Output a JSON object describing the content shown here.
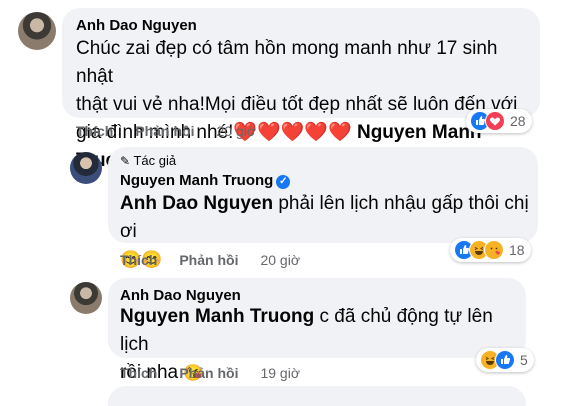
{
  "comments": [
    {
      "author": "Anh Dao Nguyen",
      "text_line1": "Chúc zai đẹp có tâm hồn mong manh như 17 sinh nhật",
      "text_line2": "thật vui vẻ nha!Mọi điều tốt đẹp nhất sẽ luôn đến với",
      "text_line3": "gia đình mình nhé!",
      "hearts": "❤️❤️❤️❤️❤️",
      "mention": "Nguyen Manh Truong",
      "like_label": "Thích",
      "reply_label": "Phản hồi",
      "time": "20 giờ",
      "reaction_count": "28",
      "reaction_icons": [
        "like-icon",
        "heart-icon"
      ]
    },
    {
      "author_tag": "Tác giả",
      "author": "Nguyen Manh Truong",
      "verified_icon": "check-badge-icon",
      "mention": "Anh Dao Nguyen",
      "text_line1": " phải lên lịch nhậu gấp thôi chị ơi",
      "emoji_line": "😊😊",
      "like_label": "Thích",
      "reply_label": "Phản hồi",
      "time": "20 giờ",
      "reaction_count": "18",
      "reaction_icons": [
        "like-icon",
        "haha-icon",
        "care-icon"
      ]
    },
    {
      "author": "Anh Dao Nguyen",
      "mention": "Nguyen Manh Truong",
      "text_line1": " c đã chủ động tự lên lịch",
      "text_line2": "rồi nha ",
      "emoji_line": "😘",
      "like_label": "Thích",
      "reply_label": "Phản hồi",
      "time": "19 giờ",
      "reaction_count": "5",
      "reaction_icons": [
        "haha-icon",
        "like-icon"
      ]
    }
  ],
  "colors": {
    "bubble": "#f0f2f5",
    "meta": "#65676b",
    "like": "#1877f2",
    "heart": "#f33e58",
    "emoji": "#f7b125"
  }
}
